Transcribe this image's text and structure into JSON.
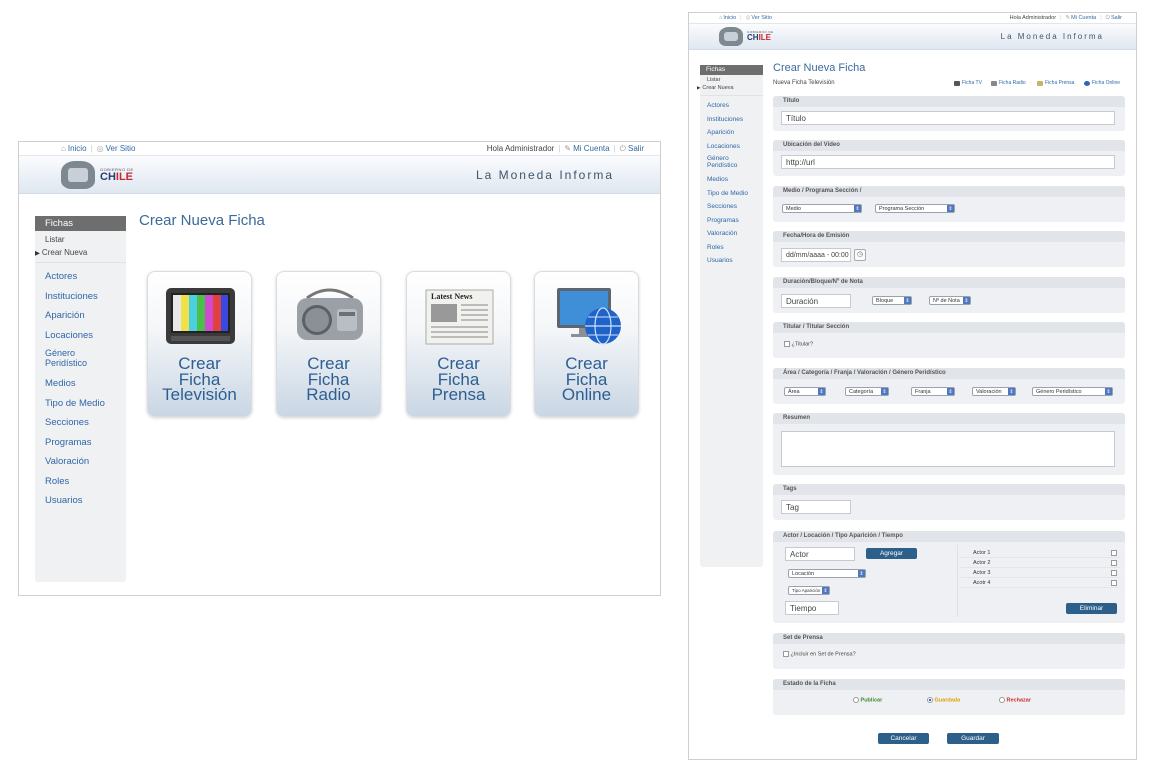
{
  "left": {
    "topbar": {
      "home": "Inicio",
      "site": "Ver Sitio",
      "greeting": "Hola Administrador",
      "account": "Mi Cuenta",
      "logout": "Salir"
    },
    "header": {
      "logo_small": "GOBIERNO DE",
      "logo_main_a": "CH",
      "logo_main_b": "ILE",
      "title": "La Moneda Informa"
    },
    "sidebar": {
      "section": "Fichas",
      "subs": [
        {
          "label": "Listar"
        },
        {
          "label": "Crear Nueva"
        }
      ],
      "items": [
        {
          "label": "Actores"
        },
        {
          "label": "Instituciones"
        },
        {
          "label": "Aparición"
        },
        {
          "label": "Locaciones"
        },
        {
          "label": "Género Peridístico"
        },
        {
          "label": "Medios"
        },
        {
          "label": "Tipo de Medio"
        },
        {
          "label": "Secciones"
        },
        {
          "label": "Programas"
        },
        {
          "label": "Valoración"
        },
        {
          "label": "Roles"
        },
        {
          "label": "Usuarios"
        }
      ]
    },
    "page_title": "Crear Nueva Ficha",
    "cards": [
      {
        "l1": "Crear",
        "l2": "Ficha",
        "l3": "Televisión",
        "icon": "tv-icon"
      },
      {
        "l1": "Crear",
        "l2": "Ficha",
        "l3": "Radio",
        "icon": "radio-icon"
      },
      {
        "l1": "Crear",
        "l2": "Ficha",
        "l3": "Prensa",
        "icon": "newspaper-icon",
        "icon_text": "Latest News"
      },
      {
        "l1": "Crear",
        "l2": "Ficha",
        "l3": "Online",
        "icon": "globe-monitor-icon"
      }
    ]
  },
  "right": {
    "topbar": {
      "home": "Inicio",
      "site": "Ver Sitio",
      "greeting": "Hola Administrador",
      "account": "Mi Cuenta",
      "logout": "Salir"
    },
    "header": {
      "logo_small": "GOBIERNO DE",
      "logo_main_a": "CH",
      "logo_main_b": "ILE",
      "title": "La Moneda Informa"
    },
    "sidebar": {
      "section": "Fichas",
      "subs": [
        {
          "label": "Listar"
        },
        {
          "label": "Crear Nueva"
        }
      ],
      "items": [
        {
          "label": "Actores"
        },
        {
          "label": "Instituciones"
        },
        {
          "label": "Aparición"
        },
        {
          "label": "Locaciones"
        },
        {
          "label": "Género Peridístico"
        },
        {
          "label": "Medios"
        },
        {
          "label": "Tipo de Medio"
        },
        {
          "label": "Secciones"
        },
        {
          "label": "Programas"
        },
        {
          "label": "Valoración"
        },
        {
          "label": "Roles"
        },
        {
          "label": "Usuarios"
        }
      ]
    },
    "page_title": "Crear Nueva Ficha",
    "subtitle": "Nueva Ficha Televisión",
    "tabs": [
      {
        "label": "Ficha TV"
      },
      {
        "label": "Ficha Radio"
      },
      {
        "label": "Ficha Prensa"
      },
      {
        "label": "Ficha Online"
      }
    ],
    "form": {
      "titulo": {
        "label": "Título",
        "placeholder": "Título"
      },
      "video": {
        "label": "Ubicación del Video",
        "placeholder": "http://url"
      },
      "medio": {
        "label": "Medio / Programa Sección /",
        "medio_sel": "Medio",
        "programa_sel": "Programa Sección"
      },
      "fecha": {
        "label": "Fecha/Hora de Emisión",
        "placeholder": "dd/mm/aaaa - 00:00"
      },
      "duracion": {
        "label": "Duración/Bloque/Nº de Nota",
        "placeholder": "Duración",
        "bloque_sel": "Bloque",
        "nota_sel": "Nº de Nota"
      },
      "titular": {
        "label": "Titular / Titular Sección",
        "check_label": "¿Titular?"
      },
      "area": {
        "label": "Área / Categoría / Franja / Valoración / Género Peridístico",
        "selects": [
          "Área",
          "Categoría",
          "Franja",
          "Valoración",
          "Género Peridístico"
        ]
      },
      "resumen": {
        "label": "Resumen"
      },
      "tags": {
        "label": "Tags",
        "placeholder": "Tag"
      },
      "actor": {
        "label": "Actor / Locación / Tipo Aparición / Tiempo",
        "actor_placeholder": "Actor",
        "add_button": "Agregar",
        "locacion_sel": "Locación",
        "tipo_sel": "Tipo Aparición",
        "tiempo_placeholder": "Tiempo",
        "delete_button": "Eliminar",
        "actors": [
          "Actor 1",
          "Actor 2",
          "Actor 3",
          "Acotr 4"
        ]
      },
      "prensa": {
        "label": "Set de Prensa",
        "check_label": "¿Incluir en Set de Prensa?"
      },
      "estado": {
        "label": "Estado de la Ficha",
        "publicar": "Publicar",
        "guardada": "Guardada",
        "rechazar": "Rechazar",
        "selected": "Guardada"
      },
      "cancel_button": "Cancelar",
      "save_button": "Guardar"
    }
  },
  "colors": {
    "accent": "#2c5f8a",
    "link": "#2e67a8",
    "publicar": "#3a8a2a",
    "guardada": "#e0a000",
    "rechazar": "#d02a2a"
  }
}
